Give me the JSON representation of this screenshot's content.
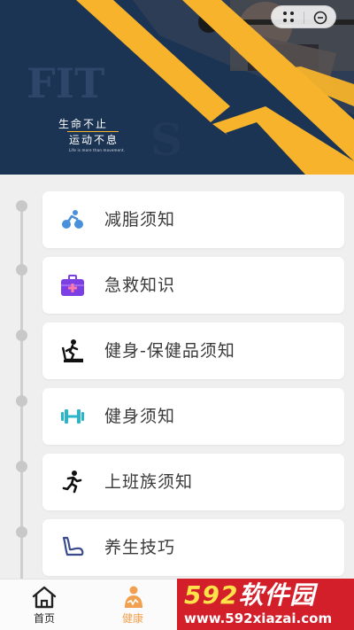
{
  "banner": {
    "slogan_line1": "生命不止",
    "slogan_line2": "运动不息",
    "slogan_line3": "Life is more than movement."
  },
  "capsule": {
    "menu_icon": "more-dots-icon",
    "close_icon": "circle-close-icon"
  },
  "menu": [
    {
      "label": "减脂须知",
      "icon": "cycling-icon",
      "color": "#4a90d9"
    },
    {
      "label": "急救知识",
      "icon": "first-aid-kit-icon",
      "color": "#7b3fe4"
    },
    {
      "label": "健身-保健品须知",
      "icon": "treadmill-icon",
      "color": "#111111"
    },
    {
      "label": "健身须知",
      "icon": "dumbbell-icon",
      "color": "#29b6c8"
    },
    {
      "label": "上班族须知",
      "icon": "running-man-icon",
      "color": "#111111"
    },
    {
      "label": "养生技巧",
      "icon": "flexed-arm-icon",
      "color": "#3a4a8c"
    }
  ],
  "tabbar": {
    "tabs": [
      {
        "label": "首页",
        "icon": "home-icon",
        "active": false
      },
      {
        "label": "健康",
        "icon": "health-icon",
        "active": true
      }
    ]
  },
  "watermark": {
    "brand_num": "592",
    "brand_text": "软件园",
    "url": "www.592xiazai.com"
  }
}
